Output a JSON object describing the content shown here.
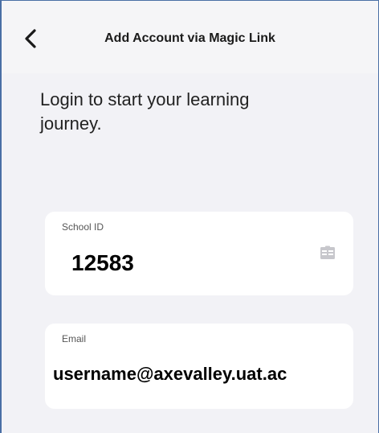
{
  "nav": {
    "title": "Add Account via Magic Link",
    "back_icon": "chevron-left-icon"
  },
  "headline": "Login to start your learning journey.",
  "form": {
    "school_id": {
      "label": "School ID",
      "value": "12583",
      "icon": "id-card-icon"
    },
    "email": {
      "label": "Email",
      "value": "username@axevalley.uat.ac"
    }
  },
  "colors": {
    "background": "#f2f2f6",
    "card": "#ffffff",
    "text": "#1a1a1a",
    "frame_border": "#4a6fa5",
    "icon": "#c7c7cc"
  }
}
